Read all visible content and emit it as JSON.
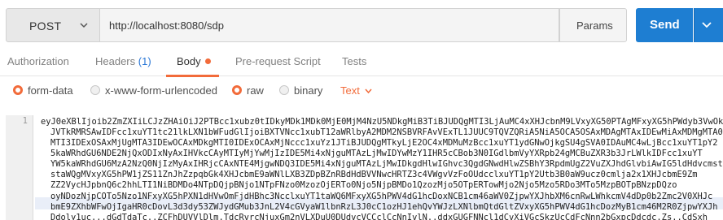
{
  "request": {
    "method": "POST",
    "url": "http://localhost:8080/sdp",
    "params_label": "Params",
    "send_label": "Send"
  },
  "tabs": [
    {
      "label": "Authorization"
    },
    {
      "label": "Headers",
      "count": "(1)"
    },
    {
      "label": "Body"
    },
    {
      "label": "Pre-request Script"
    },
    {
      "label": "Tests"
    }
  ],
  "body_types": [
    {
      "label": "form-data",
      "checked": true
    },
    {
      "label": "x-www-form-urlencoded",
      "checked": false
    },
    {
      "label": "raw",
      "checked": true
    },
    {
      "label": "binary",
      "checked": false
    }
  ],
  "language": "Text",
  "colors": {
    "accent": "#f26b3a",
    "send": "#1e7ed2",
    "link": "#2a77d6"
  },
  "editor": {
    "line_number": "1",
    "lines": [
      "eyJ0eXBlIjoib2ZmZXIiLCJzZHAiOiJ2PTBcc1xubz0tIDkyMDk1MDk0MjE0MjM4NzU5NDkgMiB3TiBJUDQgMTI3LjAuMC4xXHJcbnM9LVxyXG50PTAgMFxyXG5hPWdyb3VwOkJVTkRMRSAw",
      "JVTkRMRSAwIDFcc1xuYT1tc21lkLXN1bWFudGlIjoiBXTVNcc1xubT12aWRlbyA2MDM2NSBVRFAvVExTL1JUUC9TQVZQRiA5NiA5OCA5OSAxMDAgMTAxIDEwMiAxMDMgMTA0",
      "MTI3IDExOSAxMjUgMTA3IDEwOCAxMDkgMTI0IDExOCAxMjNccc1xuYz1JTiBJUDQgMTkyLjE2OC4xMDMuMzBcc1xuYT1ydGNwOjkgSU4gSVA0IDAuMC4wLjBcc1xuYT1pY2",
      "5kaWRhdGU6NDE2NjQxODIxNyAxIHVkcCAyMTIyMjYwMjIzIDE5Mi4xNjguMTAzLjMwIDYwMzY1IHR5cCBob3N0IGdlbmVyYXRpb24gMCBuZXR3b3JrLWlkIDFcc1xuYT",
      "YW5kaWRhdGU6MzA2NzQ0NjIzMyAxIHRjcCAxNTE4MjgwNDQ3IDE5Mi4xNjguMTAzLjMwIDkgdHlwIGhvc3QgdGNwdHlwZSBhY3RpdmUgZ2VuZXJhdGlvbiAwIG5ldHdvcmst",
      "staWQgMVxyXG5hPW1jZS11ZnJhZzpqbGk4XHJcbmE9aWNlLXB3ZDpBZnRBdHdBVVNwcHRTZ3c4VWgvVzFoOUdcclxuYT1pY2Utb3B0aW9ucz0cmlja2x1XHJcbmE9Zm",
      "ZZ2VycHJpbnQ6c2hhLTI1NiBDMDo4NTpDQjpBNjo1NTpFNzo0MzozOjERTo0Njo5NjpBMDo1QzozMjo5OTpERTowMjo2Njo5Mzo5RDo3MTo5MzpBOTpBNzpDQzo",
      "oyNDozNjpCOTo5Nzo1NFxyXG5hPXN1dHVwOmFjdHBhc3NcclxuYT1taWQ6MFxyXG5hPWV4dG1hcDoxNCB1cm46aWV0ZjpwYXJhbXM6cnRwLWhkcmV4dDp0b2Zmc2V0XHJc",
      "bmE9ZXhbWFwOjIgaHR0cDovL3d3dy53ZWJydGMub3JnL2V4cGVyaW1lbnRzL3J0cC1ozHJ1ehQvYWJzLXNlbmQtdGltZVxyXG5hPWV4dG1hcDozMyB1cm46M2R0ZjpwYXJh",
      "Ddoly1uc...dGdTdaTc..ZCFhDUVVlDlm.TdcRvrcNjuxGm2nVLXDuU0DUdvcVCCclCcNnIvlN..ddxGUGFNNcl1dCvXiVGcSkzUcCdFcNnn2bGxpcDdcdc.Zs..CdSxh"
    ]
  }
}
